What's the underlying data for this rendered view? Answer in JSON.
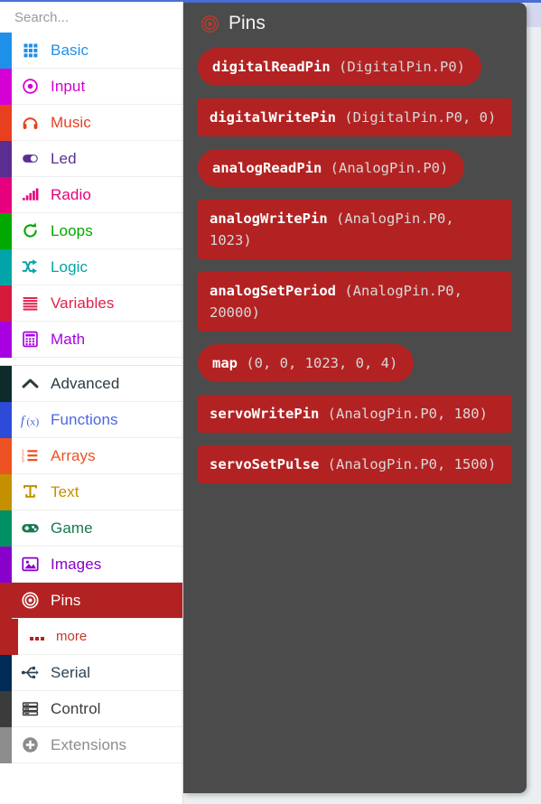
{
  "theme": {
    "accent_blue": "#4a6fd6",
    "panel_gray": "#4b4b4b",
    "block_red": "#b32222",
    "page_bg": "#eceff1"
  },
  "sidebar": {
    "search": {
      "placeholder": "Search...",
      "value": "",
      "icon": "search-icon"
    },
    "categories": [
      {
        "label": "Basic",
        "color": "#1e90e8",
        "text_color": "#1e90e8",
        "icon": "grid-icon",
        "selected": false
      },
      {
        "label": "Input",
        "color": "#d400d4",
        "text_color": "#d400d4",
        "icon": "target-dot-icon",
        "selected": false
      },
      {
        "label": "Music",
        "color": "#e8401f",
        "text_color": "#e8401f",
        "icon": "headphones-icon",
        "selected": false
      },
      {
        "label": "Led",
        "color": "#5c2d91",
        "text_color": "#5c2d91",
        "icon": "toggle-icon",
        "selected": false
      },
      {
        "label": "Radio",
        "color": "#e6007e",
        "text_color": "#e6007e",
        "icon": "signal-bars-icon",
        "selected": false
      },
      {
        "label": "Loops",
        "color": "#00a800",
        "text_color": "#00a800",
        "icon": "loop-arrow-icon",
        "selected": false
      },
      {
        "label": "Logic",
        "color": "#00a4a8",
        "text_color": "#00a4a8",
        "icon": "shuffle-icon",
        "selected": false
      },
      {
        "label": "Variables",
        "color": "#d61a3c",
        "text_color": "#e0214a",
        "icon": "lines-icon",
        "selected": false
      },
      {
        "label": "Math",
        "color": "#a800e0",
        "text_color": "#a800e0",
        "icon": "calculator-icon",
        "selected": false
      }
    ],
    "advanced_group": [
      {
        "label": "Advanced",
        "color": "#0d2b2b",
        "text_color": "#2b3b44",
        "icon": "chevron-up-icon",
        "selected": false
      },
      {
        "label": "Functions",
        "color": "#2b4bd8",
        "text_color": "#4a66e0",
        "icon": "function-icon",
        "selected": false
      },
      {
        "label": "Arrays",
        "color": "#ee5222",
        "text_color": "#ee5222",
        "icon": "ordered-list-icon",
        "selected": false
      },
      {
        "label": "Text",
        "color": "#c49000",
        "text_color": "#c49000",
        "icon": "text-t-icon",
        "selected": false
      },
      {
        "label": "Game",
        "color": "#009063",
        "text_color": "#18794e",
        "icon": "gamepad-icon",
        "selected": false
      },
      {
        "label": "Images",
        "color": "#8800cc",
        "text_color": "#8800cc",
        "icon": "image-icon",
        "selected": false
      },
      {
        "label": "Pins",
        "color": "#b32222",
        "text_color": "#ffffff",
        "icon": "bullseye-icon",
        "selected": true
      }
    ],
    "sub_item": {
      "label": "more",
      "icon": "three-dots-icon"
    },
    "after_sub": [
      {
        "label": "Serial",
        "color": "#002b55",
        "text_color": "#2b4257",
        "icon": "usb-icon",
        "selected": false
      },
      {
        "label": "Control",
        "color": "#3b3b3b",
        "text_color": "#3b3b3b",
        "icon": "server-icon",
        "selected": false
      },
      {
        "label": "Extensions",
        "color": "#8c8c8c",
        "text_color": "#8c8c8c",
        "icon": "plus-circle-icon",
        "selected": false
      }
    ]
  },
  "flyout": {
    "title": "Pins",
    "icon": "bullseye-icon",
    "blocks": [
      {
        "name": "digitalReadPin",
        "args": "(DigitalPin.P0)",
        "shape": "reporter"
      },
      {
        "name": "digitalWritePin",
        "args": "(DigitalPin.P0, 0)",
        "shape": "statement"
      },
      {
        "name": "analogReadPin",
        "args": "(AnalogPin.P0)",
        "shape": "reporter"
      },
      {
        "name": "analogWritePin",
        "args": "(AnalogPin.P0, 1023)",
        "shape": "statement"
      },
      {
        "name": "analogSetPeriod",
        "args": "(AnalogPin.P0, 20000)",
        "shape": "statement"
      },
      {
        "name": "map",
        "args": "(0, 0, 1023, 0, 4)",
        "shape": "reporter"
      },
      {
        "name": "servoWritePin",
        "args": "(AnalogPin.P0, 180)",
        "shape": "statement"
      },
      {
        "name": "servoSetPulse",
        "args": "(AnalogPin.P0, 1500)",
        "shape": "statement"
      }
    ]
  }
}
